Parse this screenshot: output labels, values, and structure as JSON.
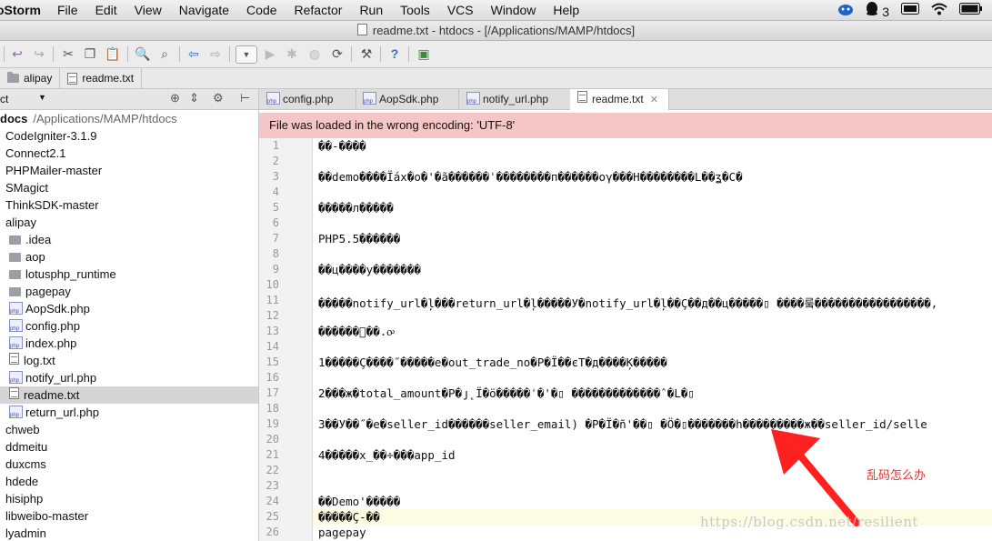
{
  "menubar": {
    "app": "oStorm",
    "items": [
      "File",
      "Edit",
      "View",
      "Navigate",
      "Code",
      "Refactor",
      "Run",
      "Tools",
      "VCS",
      "Window",
      "Help"
    ],
    "qq_count": "3"
  },
  "window_title": "readme.txt - htdocs - [/Applications/MAMP/htdocs]",
  "breadcrumb": {
    "folder": "alipay",
    "file": "readme.txt"
  },
  "project_header": {
    "label": "ct"
  },
  "tree": [
    {
      "label": "docs",
      "path": "/Applications/MAMP/htdocs",
      "indent": 0,
      "type": "root"
    },
    {
      "label": "CodeIgniter-3.1.9",
      "indent": 0,
      "type": "dir"
    },
    {
      "label": "Connect2.1",
      "indent": 0,
      "type": "dir"
    },
    {
      "label": "PHPMailer-master",
      "indent": 0,
      "type": "dir"
    },
    {
      "label": "SMagict",
      "indent": 0,
      "type": "dir"
    },
    {
      "label": "ThinkSDK-master",
      "indent": 0,
      "type": "dir"
    },
    {
      "label": "alipay",
      "indent": 0,
      "type": "dir"
    },
    {
      "label": ".idea",
      "indent": 1,
      "type": "folder"
    },
    {
      "label": "aop",
      "indent": 1,
      "type": "folder"
    },
    {
      "label": "lotusphp_runtime",
      "indent": 1,
      "type": "folder"
    },
    {
      "label": "pagepay",
      "indent": 1,
      "type": "folder"
    },
    {
      "label": "AopSdk.php",
      "indent": 1,
      "type": "php"
    },
    {
      "label": "config.php",
      "indent": 1,
      "type": "php"
    },
    {
      "label": "index.php",
      "indent": 1,
      "type": "php"
    },
    {
      "label": "log.txt",
      "indent": 1,
      "type": "txt"
    },
    {
      "label": "notify_url.php",
      "indent": 1,
      "type": "php"
    },
    {
      "label": "readme.txt",
      "indent": 1,
      "type": "txt",
      "selected": true
    },
    {
      "label": "return_url.php",
      "indent": 1,
      "type": "php"
    },
    {
      "label": "chweb",
      "indent": 0,
      "type": "dir"
    },
    {
      "label": "ddmeitu",
      "indent": 0,
      "type": "dir"
    },
    {
      "label": "duxcms",
      "indent": 0,
      "type": "dir"
    },
    {
      "label": "hdede",
      "indent": 0,
      "type": "dir"
    },
    {
      "label": "hisiphp",
      "indent": 0,
      "type": "dir"
    },
    {
      "label": "libweibo-master",
      "indent": 0,
      "type": "dir"
    },
    {
      "label": "lyadmin",
      "indent": 0,
      "type": "dir"
    }
  ],
  "tabs": [
    {
      "label": "config.php",
      "active": false
    },
    {
      "label": "AopSdk.php",
      "active": false
    },
    {
      "label": "notify_url.php",
      "active": false
    },
    {
      "label": "readme.txt",
      "active": true
    }
  ],
  "banner": "File was loaded in the wrong encoding: 'UTF-8'",
  "lines": [
    {
      "n": "1",
      "t": "��-����"
    },
    {
      "n": "2",
      "t": ""
    },
    {
      "n": "3",
      "t": "��demo����Ïáx�o�'�ã������ˈ��������п������oγ���Н��������L��ʓ�C�"
    },
    {
      "n": "4",
      "t": ""
    },
    {
      "n": "5",
      "t": "�����л�����"
    },
    {
      "n": "6",
      "t": ""
    },
    {
      "n": "7",
      "t": "PHP5.5������"
    },
    {
      "n": "8",
      "t": ""
    },
    {
      "n": "9",
      "t": "��ц����у�������"
    },
    {
      "n": "10",
      "t": ""
    },
    {
      "n": "11",
      "t": "�����notify_url�ļ���return_url�ļ�����У�notify_url�ļ��Ç��д��ц�����▯ ����뤀�����������������,"
    },
    {
      "n": "12",
      "t": ""
    },
    {
      "n": "13",
      "t": "������ꦁ��.ꭴ"
    },
    {
      "n": "14",
      "t": ""
    },
    {
      "n": "15",
      "t": "1�����Ç����˝�����e�out_trade_no�P�Ï��єТ�д����Ķ�����"
    },
    {
      "n": "16",
      "t": ""
    },
    {
      "n": "17",
      "t": "2���ж�total_amount�P�յ˛Ï�ö�����ˈ�'�▯ �������������ˆ�L�▯"
    },
    {
      "n": "18",
      "t": ""
    },
    {
      "n": "19",
      "t": "3��У��˝�e�seller_id������seller_email) �P�Ï�ñ'��▯ �Ö�▯�������h���������ж��seller_id/selle"
    },
    {
      "n": "20",
      "t": ""
    },
    {
      "n": "21",
      "t": "4�����х̲��÷���app_id"
    },
    {
      "n": "22",
      "t": ""
    },
    {
      "n": "23",
      "t": ""
    },
    {
      "n": "24",
      "t": "��Demo'�����"
    },
    {
      "n": "25",
      "t": "�����Ç-��"
    },
    {
      "n": "26",
      "t": "pagepay"
    }
  ],
  "annotation": "乱码怎么办",
  "watermark": "https://blog.csdn.net/resilient",
  "colors": {
    "banner_bg": "#f5c6c6",
    "arrow": "#ff2020",
    "selection": "#d5d5d5"
  }
}
